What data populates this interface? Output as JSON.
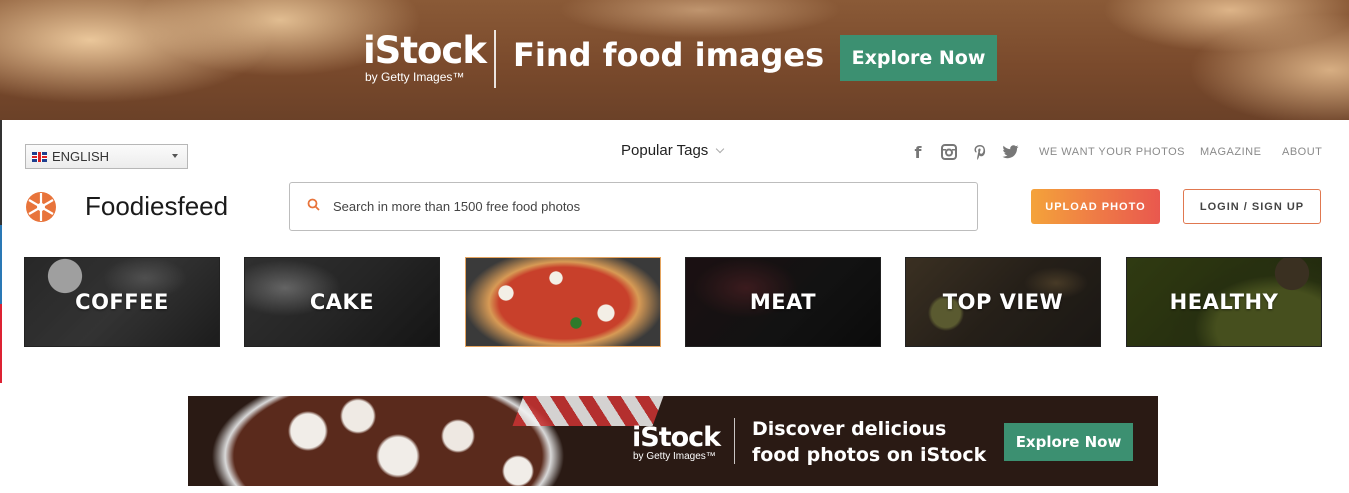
{
  "top_banner": {
    "logo": {
      "word": "iStock",
      "sub": "by Getty Images™"
    },
    "headline": "Find food images",
    "cta": "Explore Now",
    "cta_color": "#3c9071"
  },
  "header": {
    "language": {
      "selected": "ENGLISH",
      "flag_icon": "uk-flag-icon"
    },
    "popular_tags": "Popular Tags",
    "social_icons": [
      "facebook-icon",
      "instagram-icon",
      "pinterest-icon",
      "twitter-icon"
    ],
    "links": {
      "photos": "WE WANT YOUR PHOTOS",
      "magazine": "MAGAZINE",
      "about": "ABOUT"
    },
    "site_name": "Foodiesfeed",
    "search": {
      "placeholder": "Search in more than 1500 free food photos",
      "value": ""
    },
    "upload_label": "UPLOAD PHOTO",
    "login_label": "LOGIN / SIGN UP",
    "accent_color": "#ef7f45"
  },
  "categories": [
    {
      "label": "COFFEE"
    },
    {
      "label": "CAKE"
    },
    {
      "label": ""
    },
    {
      "label": "MEAT"
    },
    {
      "label": "TOP VIEW"
    },
    {
      "label": "HEALTHY"
    }
  ],
  "bottom_banner": {
    "logo": {
      "word": "iStock",
      "sub": "by Getty Images™"
    },
    "headline_line1": "Discover delicious",
    "headline_line2": "food photos on iStock",
    "cta": "Explore Now"
  }
}
